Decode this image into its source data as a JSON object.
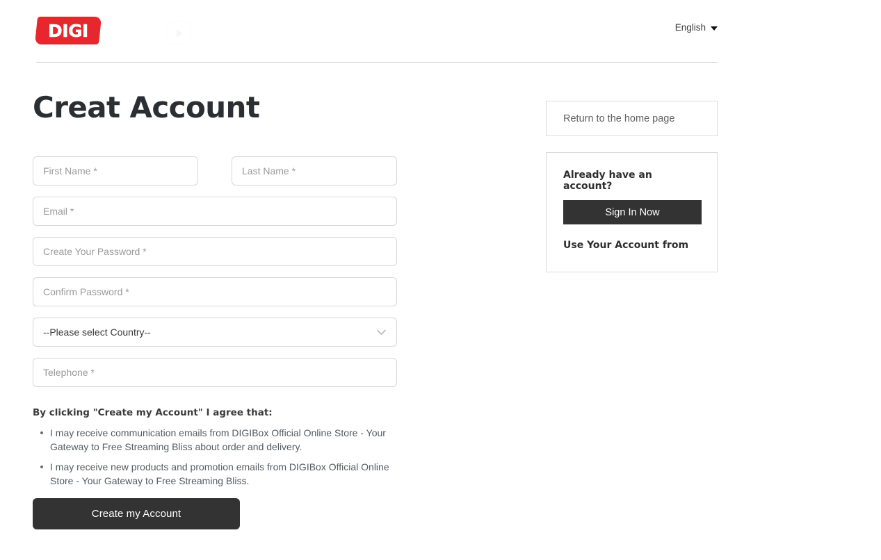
{
  "header": {
    "logo_text": "DIGI",
    "logo_color": "#e8262d",
    "watermark_icon": "play-icon",
    "language": {
      "label": "English",
      "caret_icon": "chevron-down-icon"
    }
  },
  "main": {
    "title": "Creat Account",
    "form": {
      "first_name_placeholder": "First Name *",
      "last_name_placeholder": "Last Name *",
      "email_placeholder": "Email *",
      "create_password_placeholder": "Create Your Password *",
      "confirm_password_placeholder": "Confirm Password *",
      "country_selected": "--Please select Country--",
      "country_chevron_icon": "chevron-down-icon",
      "telephone_placeholder": "Telephone *",
      "first_name_value": "",
      "last_name_value": "",
      "email_value": "",
      "create_password_value": "",
      "confirm_password_value": "",
      "telephone_value": ""
    },
    "agreement": {
      "heading": "By clicking \"Create my Account\" I agree that:",
      "items": [
        "I may receive communication emails from DIGIBox Official Online Store - Your Gateway to Free Streaming Bliss about order and delivery.",
        "I may receive new products and promotion emails from DIGIBox Official Online Store - Your Gateway to Free Streaming Bliss."
      ]
    },
    "submit_label": "Create my Account"
  },
  "aside": {
    "return_home_label": "Return to the home page",
    "account_title": "Already have an account?",
    "sign_in_label": "Sign In Now",
    "use_account_from_label": "Use Your Account from"
  },
  "theme": {
    "accent_red": "#e8262d",
    "button_dark": "#333333",
    "border_gray": "#d7d7d7",
    "placeholder_gray": "#9a9a9a"
  }
}
